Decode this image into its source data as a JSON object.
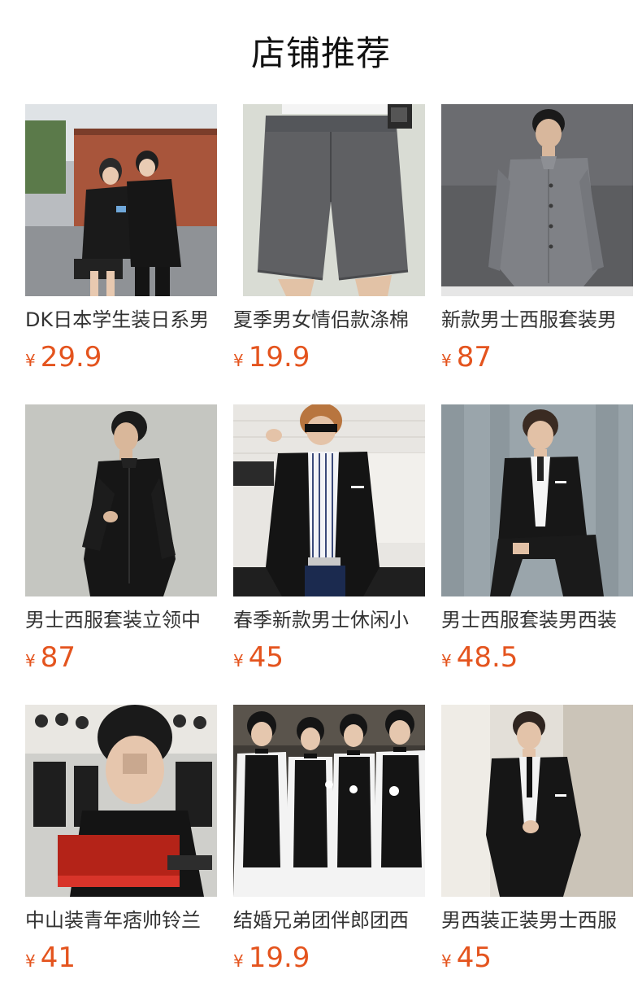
{
  "section": {
    "title": "店铺推荐"
  },
  "currency_symbol": "¥",
  "products": [
    {
      "name": "DK日本学生装日系男",
      "price": "29.9",
      "image": "students-in-black-uniforms-photo"
    },
    {
      "name": "夏季男女情侣款涤棉",
      "price": "19.9",
      "image": "gray-shorts-photo"
    },
    {
      "name": "新款男士西服套装男",
      "price": "87",
      "image": "gray-mandarin-suit-photo"
    },
    {
      "name": "男士西服套装立领中",
      "price": "87",
      "image": "black-mandarin-suit-photo"
    },
    {
      "name": "春季新款男士休闲小",
      "price": "45",
      "image": "casual-blazer-sunglasses-photo"
    },
    {
      "name": "男士西服套装男西装",
      "price": "48.5",
      "image": "black-suit-sitting-photo"
    },
    {
      "name": "中山装青年痞帅铃兰",
      "price": "41",
      "image": "drama-poster-photo"
    },
    {
      "name": "结婚兄弟团伴郎团西",
      "price": "19.9",
      "image": "groomsmen-vests-photo"
    },
    {
      "name": "男西装正装男士西服",
      "price": "45",
      "image": "black-formal-suit-photo"
    }
  ],
  "colors": {
    "price": "#e4541e",
    "title": "#111111",
    "text": "#333333"
  }
}
